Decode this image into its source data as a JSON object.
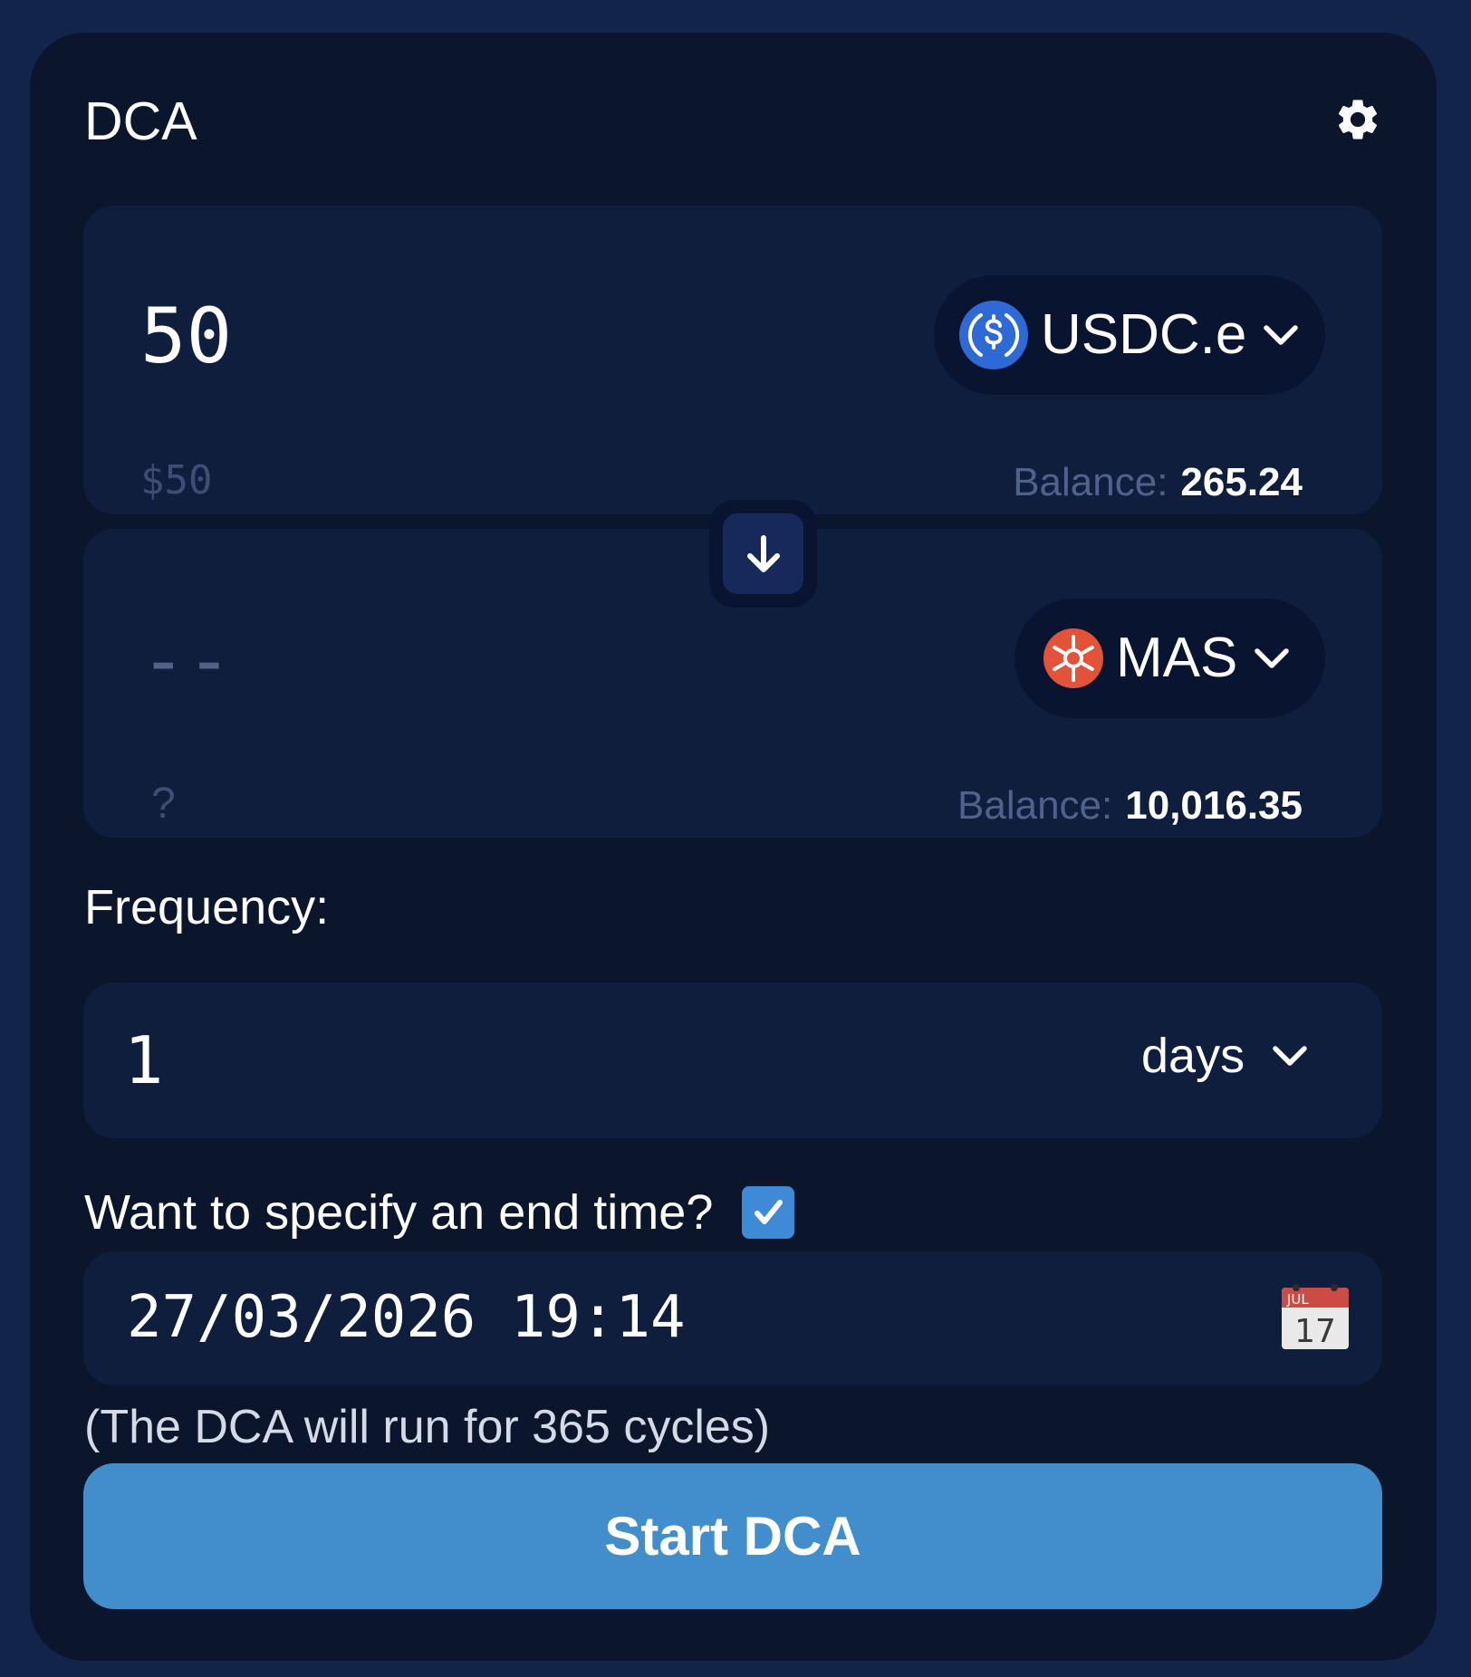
{
  "widget": {
    "title": "DCA",
    "settings_icon": "gear-icon"
  },
  "from": {
    "amount": "50",
    "usd_value": "$50",
    "token": {
      "symbol": "USDC.e",
      "icon": "usdc-token-icon",
      "color": "#2f69d6"
    },
    "balance_label": "Balance:",
    "balance_value": "265.24"
  },
  "switch": {
    "icon": "arrow-down-icon"
  },
  "to": {
    "amount": "--",
    "usd_value": "?",
    "token": {
      "symbol": "MAS",
      "icon": "mas-token-icon",
      "color": "#e2533a"
    },
    "balance_label": "Balance:",
    "balance_value": "10,016.35"
  },
  "frequency": {
    "label": "Frequency:",
    "value": "1",
    "unit": "days"
  },
  "end_time": {
    "label": "Want to specify an end time?",
    "checked": true,
    "value": "27/03/2026 19:14",
    "calendar_icon": {
      "name": "calendar-icon",
      "month": "JUL",
      "day": "17"
    }
  },
  "cycles_note": "(The DCA will run for 365 cycles)",
  "start_button": {
    "label": "Start DCA"
  },
  "colors": {
    "page_background": "#12244a",
    "card_background": "#0b162d",
    "panel_background": "#0f1e3d",
    "accent": "#428dcc",
    "muted_text": "#50618c"
  }
}
